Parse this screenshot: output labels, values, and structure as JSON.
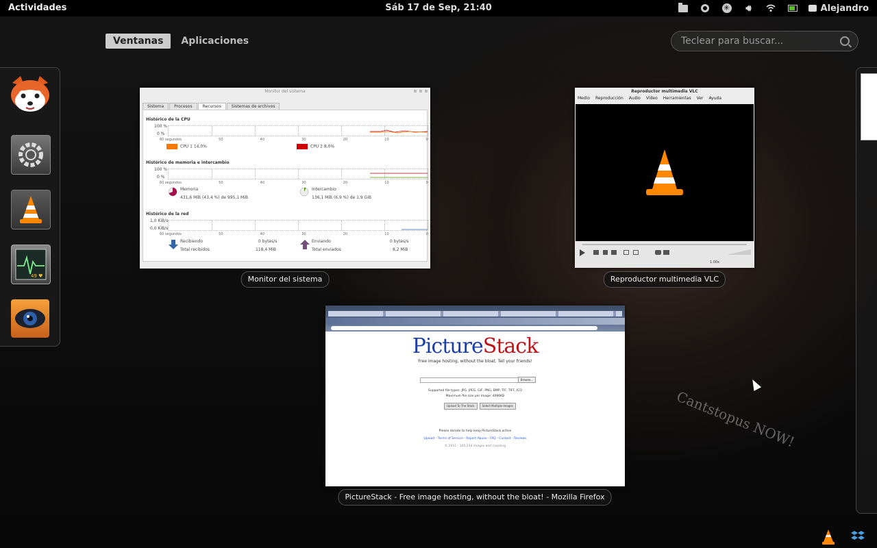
{
  "topbar": {
    "activities": "Actividades",
    "clock": "Sáb 17 de Sep, 21:40",
    "user": "Alejandro"
  },
  "overview": {
    "tabs": [
      "Ventanas",
      "Aplicaciones"
    ],
    "active_tab": "Ventanas",
    "search_placeholder": "Teclear para buscar..."
  },
  "dash": {
    "items": [
      "redfox-app-icon",
      "system-settings-icon",
      "vlc-icon",
      "system-monitor-icon",
      "eye-app-icon"
    ]
  },
  "windows": {
    "sysmon": {
      "caption": "Monitor del sistema",
      "title": "Monitor del sistema",
      "tabs": [
        "Sistema",
        "Procesos",
        "Recursos",
        "Sistemas de archivos"
      ],
      "active_tab": "Recursos",
      "cpu_title": "Histórico de la CPU",
      "cpu1": "CPU 1  14,0%",
      "cpu2": "CPU 2  8,0%",
      "mem_title": "Histórico de memoria e intercambio",
      "mem_label": "Memoria",
      "mem_value": "431,6 MiB (43,4 %) de 995,1 MiB",
      "swap_label": "Intercambio",
      "swap_value": "136,1 MiB (6,9 %) de 1,9 GiB",
      "net_title": "Histórico de la red",
      "recv_label": "Recibiendo",
      "recv_rate": "0 bytes/s",
      "recv_total_label": "Total recibidos",
      "recv_total": "118,4 MiB",
      "send_label": "Enviando",
      "send_rate": "0 bytes/s",
      "send_total_label": "Total enviados",
      "send_total": "8,2 MiB",
      "y_100": "100 %",
      "y_0": "0 %",
      "net_hi": "1,0 KiB/s",
      "net_lo": "0,0 KiB/s",
      "x_ticks": [
        "60 segundos",
        "50",
        "40",
        "30",
        "20",
        "10",
        "0"
      ],
      "cpu1_color": "#f57900",
      "cpu2_color": "#cc0000"
    },
    "vlc": {
      "caption": "Reproductor multimedia VLC",
      "title": "Reproductor multimedia VLC",
      "menu": [
        "Medio",
        "Reproducción",
        "Audio",
        "Vídeo",
        "Herramientas",
        "Ver",
        "Ayuda"
      ],
      "speed": "1.00x"
    },
    "firefox": {
      "caption": "PictureStack - Free image hosting, without the bloat! - Mozilla Firefox",
      "logo_a": "Picture",
      "logo_b": "Stack",
      "tagline": "Free image hosting, without the bloat. Tell your friends!",
      "browse": "Browse...",
      "types": "Supported file types: JPG, JPEG, GIF, PNG, BMP, TIF, TIFF, ICO",
      "max": "Maximum file size per image: 4096KB",
      "upload_btn": "Upload To The Stack",
      "multi_btn": "Select Multiple Images",
      "donate": "Please donate to help keep PictureStack active",
      "footer_links": "Upload - Terms of Service - Report Abuse - FAQ - Contact - Reviews",
      "copyright": "© 2011 - 105,234 images and counting"
    }
  },
  "wallpaper": {
    "text": "Cantstopus NOW!"
  },
  "colors": {
    "accent": "#5bbf2a",
    "vlc_orange": "#ff8800"
  }
}
